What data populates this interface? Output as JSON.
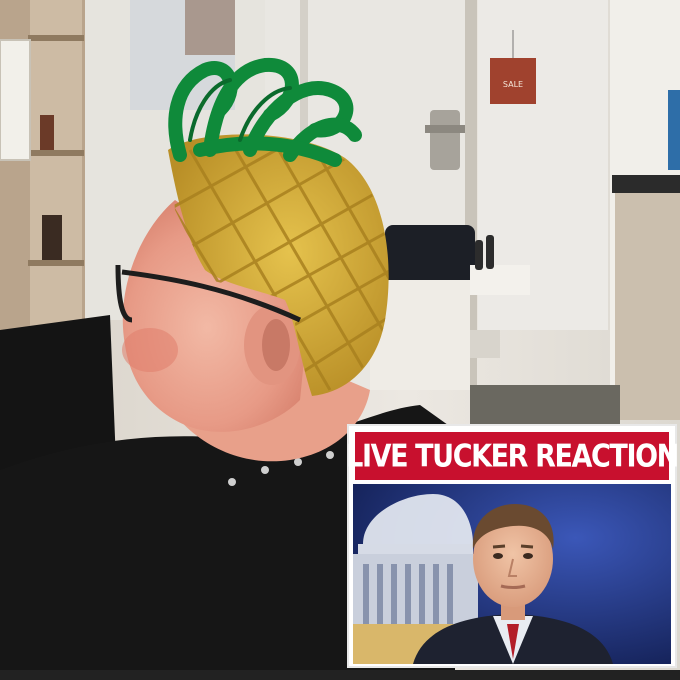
{
  "meme": {
    "banner_text": "LIVE TUCKER REACTION"
  },
  "scene": {
    "salon_sign_text": "SALE",
    "colors": {
      "hair_green": "#0f8a3a",
      "pineapple_yellow": "#d9b23c",
      "banner_red": "#c8102e",
      "studio_blue": "#1b2e7a",
      "cape_black": "#161616"
    }
  }
}
